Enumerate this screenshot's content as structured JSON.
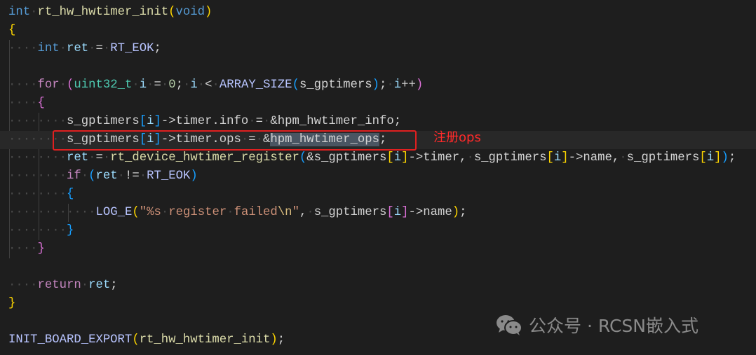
{
  "editor": {
    "theme_colors": {
      "background": "#1e1e1e",
      "keyword": "#569cd6",
      "control": "#c586c0",
      "function": "#dcdcaa",
      "variable": "#9cdcfe",
      "string": "#ce9178"
    },
    "current_line": 7,
    "lines": [
      [
        [
          "int",
          "kw"
        ],
        [
          " ",
          ""
        ],
        [
          "rt_hw_hwtimer_init",
          "fn"
        ],
        [
          "(",
          "b1"
        ],
        [
          "void",
          "kw"
        ],
        [
          ")",
          "b1"
        ]
      ],
      [
        [
          "{",
          "b1"
        ]
      ],
      [
        [
          "    ",
          ""
        ],
        [
          "int",
          "kw"
        ],
        [
          " ",
          ""
        ],
        [
          "ret",
          "var"
        ],
        [
          " = ",
          ""
        ],
        [
          "RT_EOK",
          "mac"
        ],
        [
          ";",
          ""
        ]
      ],
      [],
      [
        [
          "    ",
          ""
        ],
        [
          "for",
          "ctl"
        ],
        [
          " ",
          ""
        ],
        [
          "(",
          "b2"
        ],
        [
          "uint32_t",
          "type"
        ],
        [
          " ",
          ""
        ],
        [
          "i",
          "var"
        ],
        [
          " = ",
          ""
        ],
        [
          "0",
          "num"
        ],
        [
          "; ",
          ""
        ],
        [
          "i",
          "var"
        ],
        [
          " < ",
          ""
        ],
        [
          "ARRAY_SIZE",
          "mac"
        ],
        [
          "(",
          "b3"
        ],
        [
          "s_gptimers",
          ""
        ],
        [
          ")",
          "b3"
        ],
        [
          "; ",
          ""
        ],
        [
          "i",
          "var"
        ],
        [
          "++",
          ""
        ],
        [
          ")",
          "b2"
        ]
      ],
      [
        [
          "    ",
          ""
        ],
        [
          "{",
          "b2"
        ]
      ],
      [
        [
          "        ",
          ""
        ],
        [
          "s_gptimers",
          ""
        ],
        [
          "[",
          "b3"
        ],
        [
          "i",
          "var"
        ],
        [
          "]",
          "b3"
        ],
        [
          "->timer.info = &hpm_hwtimer_info;",
          ""
        ]
      ],
      [
        [
          "        ",
          ""
        ],
        [
          "s_gptimers",
          ""
        ],
        [
          "[",
          "b3"
        ],
        [
          "i",
          "var"
        ],
        [
          "]",
          "b3"
        ],
        [
          "->timer.ops = &",
          ""
        ],
        [
          "hpm_hwtimer_ops",
          "sel"
        ],
        [
          ";",
          ""
        ]
      ],
      [
        [
          "        ",
          ""
        ],
        [
          "ret",
          "var"
        ],
        [
          " = ",
          ""
        ],
        [
          "rt_device_hwtimer_register",
          "fn"
        ],
        [
          "(",
          "b3"
        ],
        [
          "&s_gptimers",
          ""
        ],
        [
          "[",
          "b1"
        ],
        [
          "i",
          "var"
        ],
        [
          "]",
          "b1"
        ],
        [
          "->timer, s_gptimers",
          ""
        ],
        [
          "[",
          "b1"
        ],
        [
          "i",
          "var"
        ],
        [
          "]",
          "b1"
        ],
        [
          "->name, s_gptimers",
          ""
        ],
        [
          "[",
          "b1"
        ],
        [
          "i",
          "var"
        ],
        [
          "]",
          "b1"
        ],
        [
          ")",
          "b3"
        ],
        [
          ";",
          ""
        ]
      ],
      [
        [
          "        ",
          ""
        ],
        [
          "if",
          "ctl"
        ],
        [
          " ",
          ""
        ],
        [
          "(",
          "b3"
        ],
        [
          "ret",
          "var"
        ],
        [
          " != ",
          ""
        ],
        [
          "RT_EOK",
          "mac"
        ],
        [
          ")",
          "b3"
        ]
      ],
      [
        [
          "        ",
          ""
        ],
        [
          "{",
          "b3"
        ]
      ],
      [
        [
          "            ",
          ""
        ],
        [
          "LOG_E",
          "mac"
        ],
        [
          "(",
          "b1"
        ],
        [
          "\"%s register failed",
          "str"
        ],
        [
          "\\n",
          "esc"
        ],
        [
          "\"",
          "str"
        ],
        [
          ", s_gptimers",
          ""
        ],
        [
          "[",
          "b2"
        ],
        [
          "i",
          "var"
        ],
        [
          "]",
          "b2"
        ],
        [
          "->name",
          ""
        ],
        [
          ")",
          "b1"
        ],
        [
          ";",
          ""
        ]
      ],
      [
        [
          "        ",
          ""
        ],
        [
          "}",
          "b3"
        ]
      ],
      [
        [
          "    ",
          ""
        ],
        [
          "}",
          "b2"
        ]
      ],
      [],
      [
        [
          "    ",
          ""
        ],
        [
          "return",
          "ctl"
        ],
        [
          " ",
          ""
        ],
        [
          "ret",
          "var"
        ],
        [
          ";",
          ""
        ]
      ],
      [
        [
          "}",
          "b1"
        ]
      ],
      [],
      [
        [
          "INIT_BOARD_EXPORT",
          "mac"
        ],
        [
          "(",
          "b1"
        ],
        [
          "rt_hw_hwtimer_init",
          "fn"
        ],
        [
          ")",
          "b1"
        ],
        [
          ";",
          ""
        ]
      ]
    ]
  },
  "annotation": {
    "label": "注册ops",
    "color": "#ff2a2a"
  },
  "watermark": {
    "icon": "wechat-icon",
    "text": "公众号 · RCSN嵌入式"
  }
}
